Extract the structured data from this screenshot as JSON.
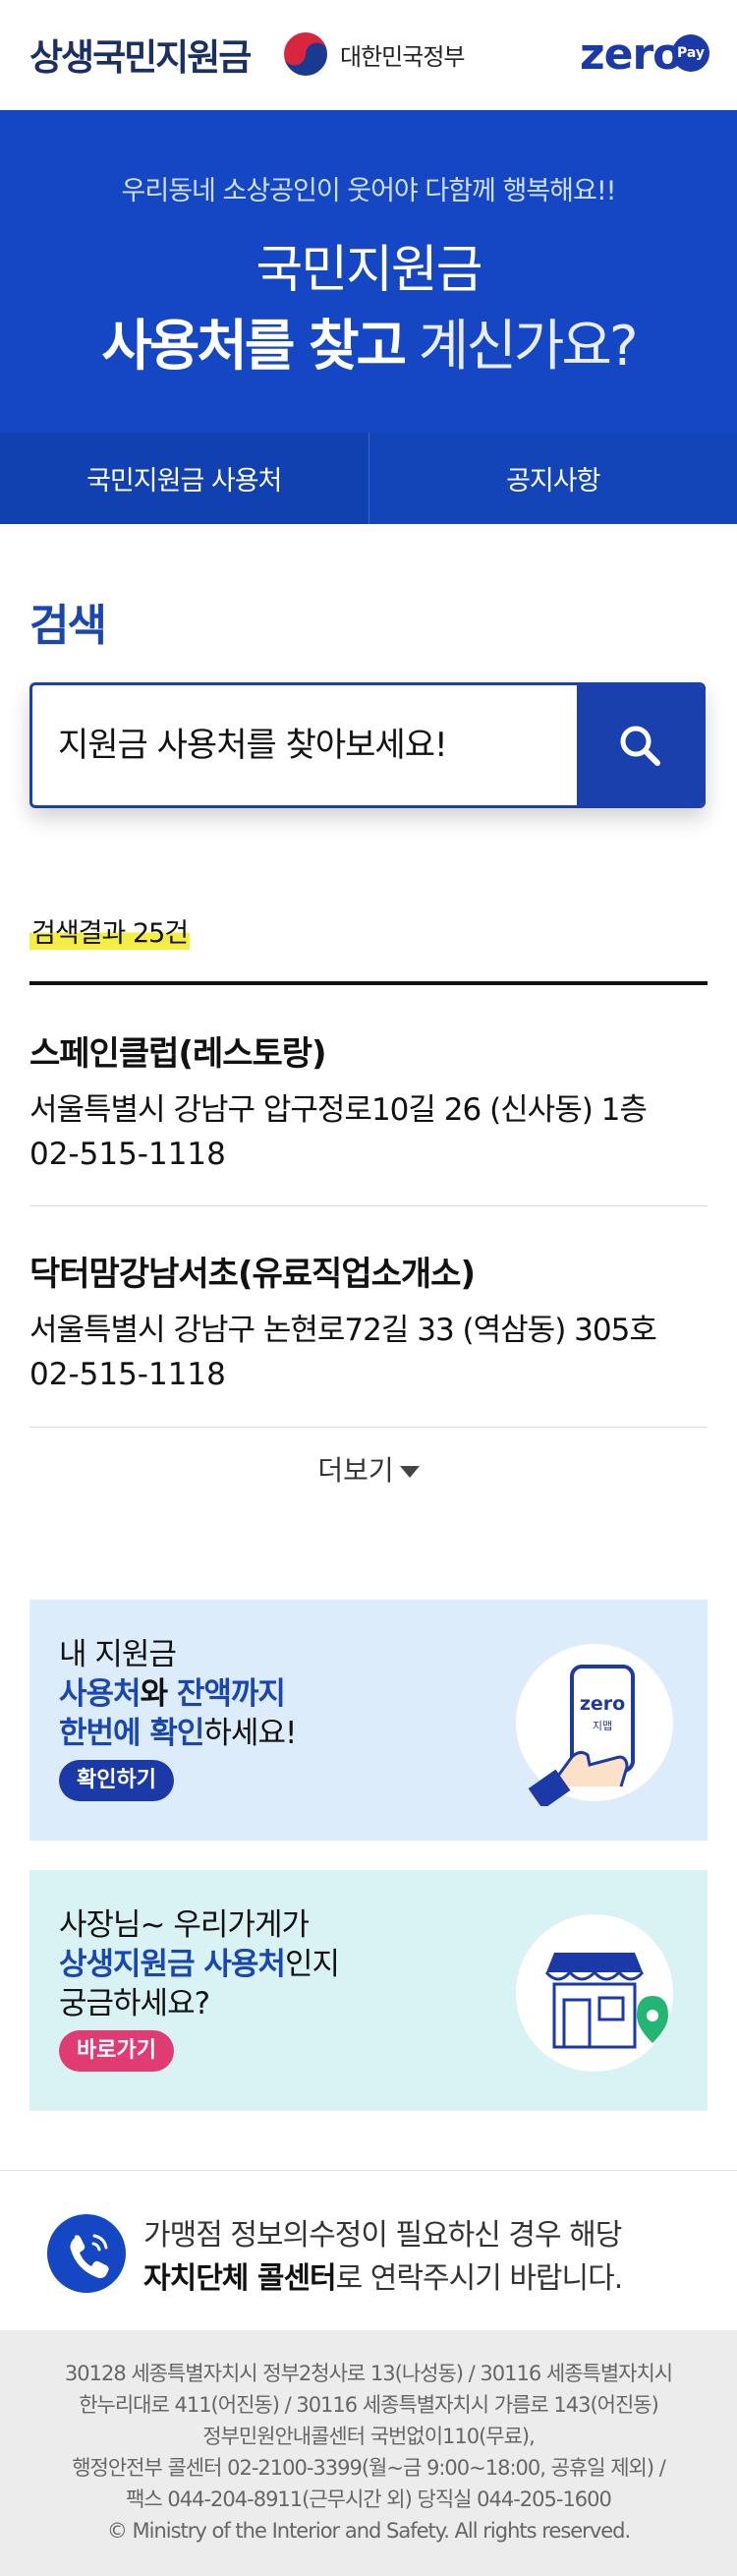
{
  "header": {
    "brand_title": "상생국민지원금",
    "gov_label": "대한민국정부",
    "zero_logo": "zero",
    "pay_badge": "Pay"
  },
  "hero": {
    "subtitle": "우리동네 소상공인이 웃어야 다함께 행복해요!!",
    "line1": "국민지원금",
    "line2_bold": "사용처를 찾고",
    "line2_light": " 계신가요?"
  },
  "tabs": [
    {
      "label": "국민지원금 사용처"
    },
    {
      "label": "공지사항"
    }
  ],
  "search": {
    "title": "검색",
    "placeholder": "지원금 사용처를 찾아보세요!",
    "result_count": "검색결과 25건"
  },
  "results": [
    {
      "name": "스페인클럽(레스토랑)",
      "address": "서울특별시 강남구 압구정로10길 26 (신사동) 1층",
      "phone": "02-515-1118"
    },
    {
      "name": "닥터맘강남서초(유료직업소개소)",
      "address": "서울특별시 강남구 논현로72길 33 (역삼동) 305호",
      "phone": "02-515-1118"
    }
  ],
  "more_label": "더보기",
  "banner1": {
    "line1": "내 지원금",
    "line2_hl1": "사용처",
    "line2_mid": "와 ",
    "line2_hl2": "잔액까지",
    "line3_hl": "한번에 확인",
    "line3_rest": "하세요!",
    "button": "확인하기",
    "phone_logo": "zero",
    "phone_sub": "지맵"
  },
  "banner2": {
    "line1": "사장님~ 우리가게가",
    "line2_hl": "상생지원금 사용처",
    "line2_rest": "인지",
    "line3": "궁금하세요?",
    "button": "바로가기"
  },
  "call": {
    "line1": "가맹점 정보의수정이 필요하신 경우 해당",
    "line2_bold": "자치단체 콜센터",
    "line2_rest": "로 연락주시기 바랍니다."
  },
  "footer": {
    "lines": [
      "30128 세종특별자치시 정부2청사로 13(나성동) / 30116 세종특별자치시",
      "한누리대로 411(어진동) / 30116 세종특별자치시 가름로 143(어진동)",
      "정부민원안내콜센터 국번없이110(무료),",
      "행정안전부 콜센터 02-2100-3399(월~금 9:00~18:00, 공휴일 제외) /",
      "팩스 044-204-8911(근무시간 외) 당직실 044-205-1600",
      "© Ministry of the Interior and Safety. All rights reserved."
    ]
  },
  "colors": {
    "primary": "#1546c4",
    "navy": "#1b3aa8",
    "highlight": "#f4ee44",
    "pink": "#e03c73"
  }
}
